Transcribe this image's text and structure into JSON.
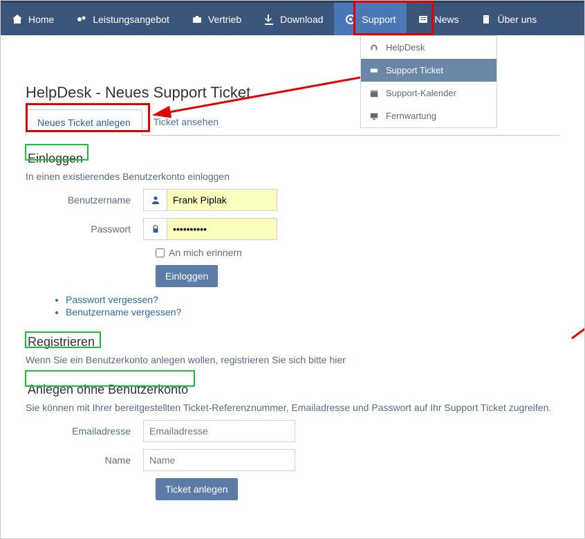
{
  "nav": {
    "home": "Home",
    "leistung": "Leistungsangebot",
    "vertrieb": "Vertrieb",
    "download": "Download",
    "support": "Support",
    "news": "News",
    "about": "Über uns"
  },
  "dropdown": {
    "helpdesk": "HelpDesk",
    "supportticket": "Support Ticket",
    "kalender": "Support-Kalender",
    "fernwartung": "Fernwartung"
  },
  "page": {
    "title": "HelpDesk - Neues Support Ticket"
  },
  "tabs": {
    "new": "Neues Ticket anlegen",
    "view": "Ticket ansehen"
  },
  "login": {
    "heading": "Einloggen",
    "hint": "In einen existierendes Benutzerkonto einloggen",
    "username_label": "Benutzername",
    "username_value": "Frank Piplak",
    "password_label": "Passwort",
    "password_value": "••••••••••",
    "remember_label": "An mich erinnern",
    "submit": "Einloggen",
    "forgot_pw": "Passwort vergessen?",
    "forgot_un": "Benutzername vergessen?"
  },
  "register": {
    "heading": "Registrieren",
    "hint": "Wenn Sie ein Benutzerkonto anlegen wollen, registrieren Sie sich bitte hier"
  },
  "guest": {
    "heading": "Anlegen ohne Benutzerkonto",
    "hint": "Sie können mit Ihrer bereitgestellten Ticket-Referenznummer, Emailadresse und Passwort auf Ihr Support Ticket zugreifen.",
    "email_label": "Emailadresse",
    "email_placeholder": "Emailadresse",
    "name_label": "Name",
    "name_placeholder": "Name",
    "submit": "Ticket anlegen"
  }
}
